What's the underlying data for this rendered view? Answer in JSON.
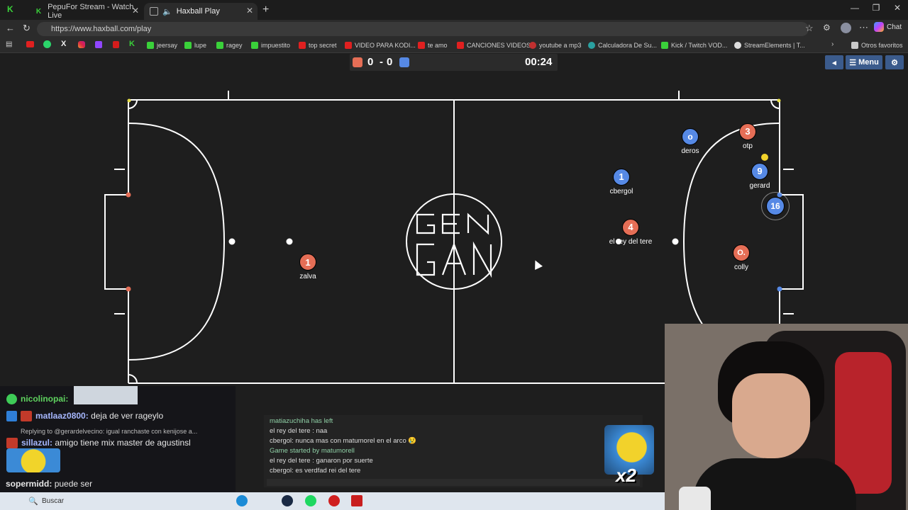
{
  "browser": {
    "tabs": [
      {
        "title": "PepuFor Stream - Watch Live",
        "active": false
      },
      {
        "title": "Haxball Play",
        "active": true
      }
    ],
    "url": "https://www.haxball.com/play",
    "chat_button": "Chat",
    "bookmarks": [
      {
        "label": "jeersay",
        "color": "#3ad13a"
      },
      {
        "label": "lupe",
        "color": "#3ad13a"
      },
      {
        "label": "ragey",
        "color": "#3ad13a"
      },
      {
        "label": "impuestito",
        "color": "#3ad13a"
      },
      {
        "label": "top secret",
        "color": "#e02020"
      },
      {
        "label": "VIDEO PARA KODI...",
        "color": "#e02020"
      },
      {
        "label": "te amo",
        "color": "#e02020"
      },
      {
        "label": "CANCIONES VIDEOS",
        "color": "#e02020"
      },
      {
        "label": "youtube a mp3",
        "color": "#c03030"
      },
      {
        "label": "Calculadora De Su...",
        "color": "#2aa1a1"
      },
      {
        "label": "Kick / Twitch VOD...",
        "color": "#3ad13a"
      },
      {
        "label": "StreamElements | T...",
        "color": "#dddddd"
      }
    ],
    "other_favorites": "Otros favoritos"
  },
  "game": {
    "score_red": "0",
    "score_separator": "-",
    "score_blue": "0",
    "timer": "00:24",
    "menu_label": "Menu",
    "center_logo": [
      "GEN",
      "GAN"
    ],
    "colors": {
      "red": "#e56e56",
      "blue": "#5689e5",
      "field": "#1e1e1e",
      "lines": "#ffffff"
    },
    "players": [
      {
        "team": "red",
        "number": "1",
        "name": "zalva"
      },
      {
        "team": "red",
        "number": "4",
        "name": "el rey del tere"
      },
      {
        "team": "red",
        "number": "3",
        "name": "otp"
      },
      {
        "team": "red",
        "number": "O.",
        "name": "colly"
      },
      {
        "team": "blue",
        "number": "o",
        "name": "deros"
      },
      {
        "team": "blue",
        "number": "1",
        "name": "cbergol"
      },
      {
        "team": "blue",
        "number": "9",
        "name": "gerard"
      },
      {
        "team": "blue",
        "number": "16",
        "name": ""
      }
    ]
  },
  "game_chat": [
    {
      "text": "matiazuchiha has left",
      "kind": "system"
    },
    {
      "text": "el rey del tere : naa",
      "kind": "msg"
    },
    {
      "text": "cbergol: nunca mas con matumorel en el arco 😢",
      "kind": "msg"
    },
    {
      "text": "Game started by matumorell",
      "kind": "system"
    },
    {
      "text": "el rey del tere : ganaron por suerte",
      "kind": "msg"
    },
    {
      "text": "cbergol: es verdfad rei del tere",
      "kind": "msg"
    }
  ],
  "stream_chat": [
    {
      "user": "nicolinopai:",
      "text": "",
      "color": "#5fd35f"
    },
    {
      "user": "matlaaz0800:",
      "text": "deja de ver rageylo",
      "color": "#a7b8ff"
    },
    {
      "reply": "Replying to @gerardelvecino: igual ranchaste con kenijose a..."
    },
    {
      "user": "sillazul:",
      "text": "amigo tiene mix master de agustinsl",
      "color": "#a7b8ff"
    },
    {
      "user": "sopermidd:",
      "text": "puede ser",
      "color": "#e6e6e6"
    }
  ],
  "overlay": {
    "multiplier": "x2"
  },
  "taskbar": {
    "search": "Buscar"
  }
}
